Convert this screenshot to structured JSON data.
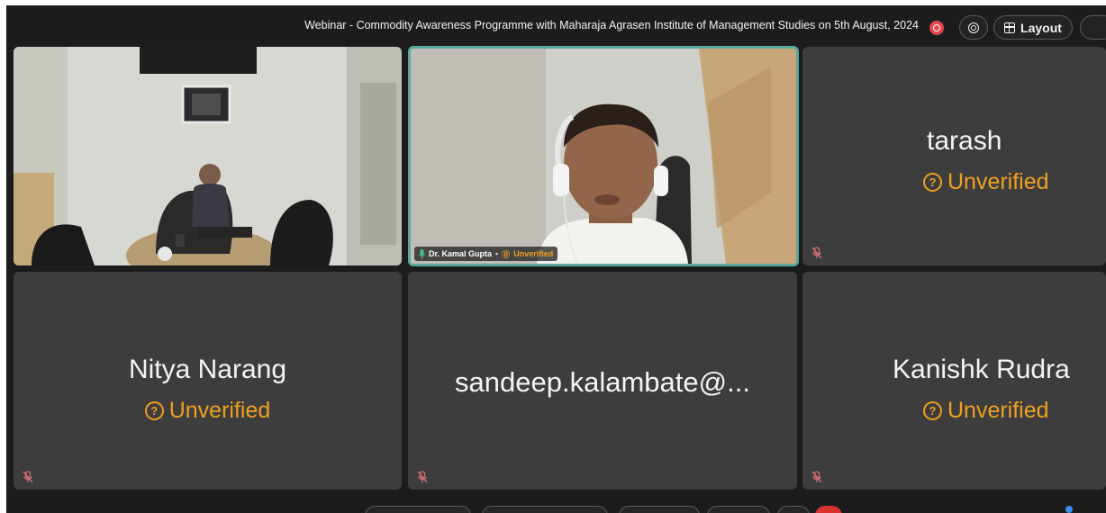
{
  "meeting": {
    "title": "Webinar - Commodity Awareness Programme with Maharaja Agrasen Institute of Management Studies on 5th August, 2024"
  },
  "toolbar": {
    "layout_label": "Layout"
  },
  "participants": [
    {
      "name": "",
      "status": "",
      "video": true,
      "scene": "conference-room"
    },
    {
      "name": "Dr. Kamal Gupta",
      "status": "Unverified",
      "video": true,
      "active_speaker": true,
      "mic": "on"
    },
    {
      "name": "tarash",
      "status": "Unverified",
      "video": false,
      "mic": "off"
    },
    {
      "name": "Nitya Narang",
      "status": "Unverified",
      "video": false,
      "mic": "off"
    },
    {
      "name": "sandeep.kalambate@...",
      "status": "",
      "video": false,
      "mic": "off"
    },
    {
      "name": "Kanishk Rudra",
      "status": "Unverified",
      "video": false,
      "mic": "off"
    }
  ],
  "icons": {
    "record": "record-icon",
    "zoom": "zoom-icon",
    "layout": "grid-icon",
    "mic_off": "mic-off-icon",
    "mic_on": "mic-on-icon",
    "unverified": "question-circle-icon"
  },
  "colors": {
    "background": "#1c1c1c",
    "tile": "#3d3d3d",
    "unverified": "#f0a020",
    "active_speaker_border": "#5aa7a0",
    "record": "#e5484d",
    "end_call": "#d9312f"
  }
}
